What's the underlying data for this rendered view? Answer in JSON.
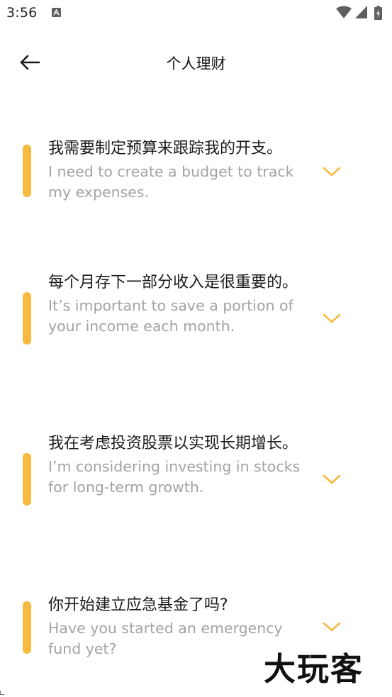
{
  "status_bar": {
    "time": "3:56",
    "notification_icon": "a-letter-box-icon",
    "wifi_icon": "wifi-icon",
    "signal_icon": "cell-signal-icon",
    "battery_icon": "battery-charging-icon"
  },
  "header": {
    "title": "个人理财",
    "back_icon": "arrow-left-icon"
  },
  "colors": {
    "accent": "#f7b93e",
    "primary_text": "#1a1a1a",
    "secondary_text": "#a3a3a3",
    "background": "#ffffff"
  },
  "phrases": [
    {
      "zh": "我需要制定预算来跟踪我的开支。",
      "en": "I need to create a budget to track my expenses.",
      "expand_icon": "chevron-down-icon"
    },
    {
      "zh": "每个月存下一部分收入是很重要的。",
      "en": "It’s important to save a portion of your income each month.",
      "expand_icon": "chevron-down-icon"
    },
    {
      "zh": "我在考虑投资股票以实现长期增长。",
      "en": "I’m considering investing in stocks for long-term growth.",
      "expand_icon": "chevron-down-icon"
    },
    {
      "zh": "你开始建立应急基金了吗?",
      "en": "Have you started an emergency fund yet?",
      "expand_icon": "chevron-down-icon"
    }
  ],
  "watermark": {
    "text": "大玩客"
  }
}
